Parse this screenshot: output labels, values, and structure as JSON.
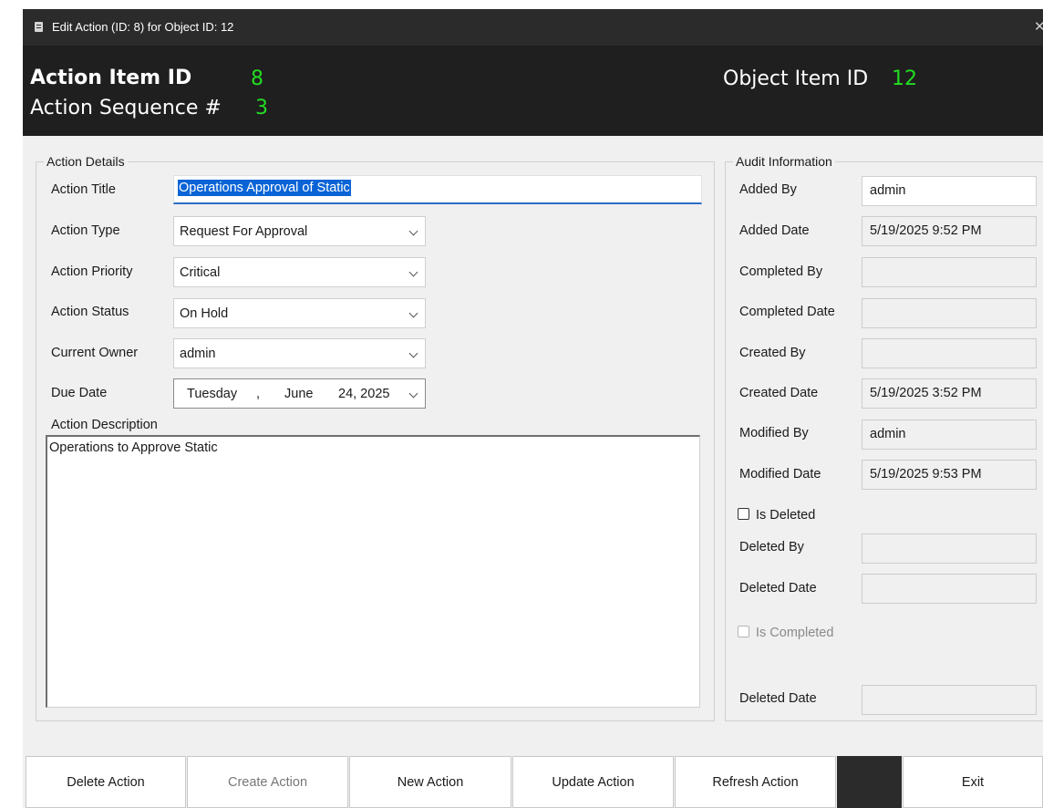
{
  "window": {
    "title": "Edit Action (ID: 8) for Object ID: 12"
  },
  "header": {
    "action_item_label": "Action Item ID",
    "action_item_value": "8",
    "sequence_label": "Action Sequence #",
    "sequence_value": "3",
    "object_item_label": "Object Item ID",
    "object_item_value": "12"
  },
  "action_details": {
    "group_title": "Action Details",
    "title_label": "Action Title",
    "title_value": "Operations Approval of Static",
    "type_label": "Action Type",
    "type_value": "Request For Approval",
    "priority_label": "Action Priority",
    "priority_value": "Critical",
    "status_label": "Action Status",
    "status_value": "On Hold",
    "owner_label": "Current Owner",
    "owner_value": "admin",
    "due_label": "Due Date",
    "due_weekday": "Tuesday",
    "due_sep": ",",
    "due_month": "June",
    "due_day_year": "24, 2025",
    "description_label": "Action Description",
    "description_value": "Operations to Approve Static"
  },
  "audit": {
    "group_title": "Audit Information",
    "added_by_label": "Added By",
    "added_by_value": "admin",
    "added_date_label": "Added Date",
    "added_date_value": "5/19/2025 9:52 PM",
    "completed_by_label": "Completed By",
    "completed_by_value": "",
    "completed_date_label": "Completed Date",
    "completed_date_value": "",
    "created_by_label": "Created By",
    "created_by_value": "",
    "created_date_label": "Created Date",
    "created_date_value": "5/19/2025 3:52 PM",
    "modified_by_label": "Modified By",
    "modified_by_value": "admin",
    "modified_date_label": "Modified Date",
    "modified_date_value": "5/19/2025 9:53 PM",
    "is_deleted_label": "Is Deleted",
    "deleted_by_label": "Deleted By",
    "deleted_by_value": "",
    "deleted_date_label": "Deleted Date",
    "deleted_date_value": "",
    "is_completed_label": "Is Completed",
    "deleted_date2_label": "Deleted Date",
    "deleted_date2_value": ""
  },
  "buttons": {
    "delete": "Delete Action",
    "create": "Create Action",
    "new": "New Action",
    "update": "Update Action",
    "refresh": "Refresh Action",
    "exit": "Exit"
  },
  "colors": {
    "accent_green": "#22dd22",
    "header_bg": "#1f1f1f",
    "selection_blue": "#0a64d6"
  }
}
